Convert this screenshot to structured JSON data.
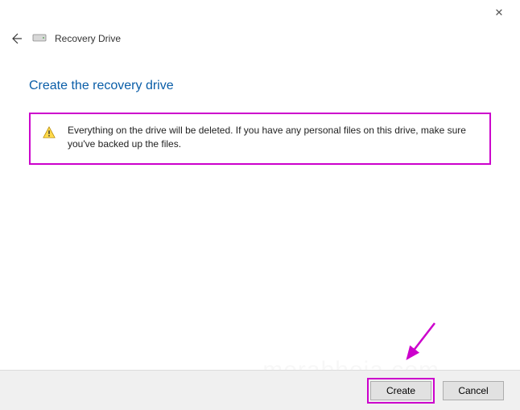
{
  "titlebar": {
    "close_glyph": "✕"
  },
  "header": {
    "window_title": "Recovery Drive"
  },
  "page": {
    "heading": "Create the recovery drive",
    "warning_text": "Everything on the drive will be deleted. If you have any personal files on this drive, make sure you've backed up the files."
  },
  "buttons": {
    "create": "Create",
    "cancel": "Cancel"
  },
  "annotation": {
    "highlight_color": "#cc00cc"
  }
}
